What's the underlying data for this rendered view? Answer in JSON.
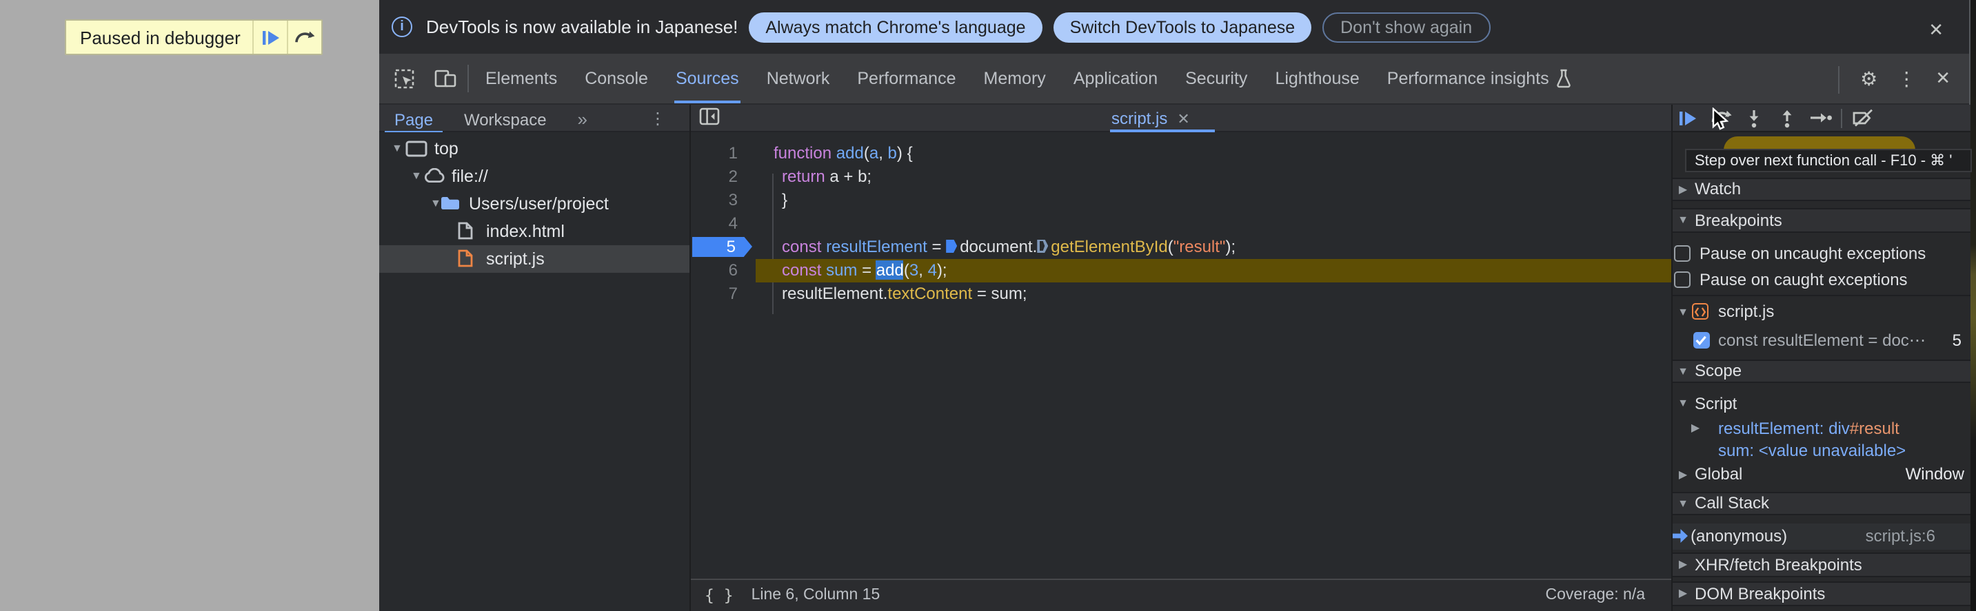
{
  "overlay": {
    "paused_label": "Paused in debugger"
  },
  "banner": {
    "info_icon_glyph": "i",
    "message": "DevTools is now available in Japanese!",
    "buttons": [
      {
        "label": "Always match Chrome's language",
        "style": "filled"
      },
      {
        "label": "Switch DevTools to Japanese",
        "style": "filled"
      },
      {
        "label": "Don't show again",
        "style": "outlined"
      }
    ],
    "close_icon": "✕"
  },
  "icons": {
    "gear": "⚙",
    "more_vertical": "⋮",
    "close": "✕",
    "overflow_chevrons": "»",
    "pretty_print": "{ }",
    "expanded_arrow": "▼",
    "collapsed_arrow": "▶"
  },
  "tabs_row": {
    "selected": "Sources",
    "tabs": [
      {
        "label": "Elements"
      },
      {
        "label": "Console"
      },
      {
        "label": "Sources"
      },
      {
        "label": "Network"
      },
      {
        "label": "Performance"
      },
      {
        "label": "Memory"
      },
      {
        "label": "Application"
      },
      {
        "label": "Security"
      },
      {
        "label": "Lighthouse"
      },
      {
        "label": "Performance insights",
        "flask": true
      }
    ]
  },
  "sources_nav": {
    "tabs": [
      {
        "label": "Page",
        "selected": true
      },
      {
        "label": "Workspace",
        "selected": false
      }
    ],
    "overflow_icon": "»",
    "more_icon": "⋮"
  },
  "file_tree": {
    "items": [
      {
        "label": "top",
        "icon": "frame",
        "depth": 0,
        "expanded": true
      },
      {
        "label": "file://",
        "icon": "cloud",
        "depth": 1,
        "expanded": true
      },
      {
        "label": "Users/user/project",
        "icon": "folder",
        "depth": 2,
        "expanded": true
      },
      {
        "label": "index.html",
        "icon": "file",
        "depth": 3
      },
      {
        "label": "script.js",
        "icon": "file-js",
        "depth": 3,
        "selected": true
      }
    ]
  },
  "editor": {
    "tab": {
      "label": "script.js",
      "close_icon": "✕"
    },
    "breakpoint_line": 5,
    "paused_line": 6,
    "lines": [
      {
        "n": 1,
        "indent": 0,
        "tokens": [
          {
            "t": "function",
            "c": "kw"
          },
          {
            "t": " ",
            "c": "pl"
          },
          {
            "t": "add",
            "c": "def"
          },
          {
            "t": "(",
            "c": "pl"
          },
          {
            "t": "a",
            "c": "def"
          },
          {
            "t": ", ",
            "c": "pl"
          },
          {
            "t": "b",
            "c": "def"
          },
          {
            "t": ") {",
            "c": "pl"
          }
        ]
      },
      {
        "n": 2,
        "indent": 1,
        "tokens": [
          {
            "t": "return",
            "c": "kw"
          },
          {
            "t": " a + b;",
            "c": "pl"
          }
        ]
      },
      {
        "n": 3,
        "indent": 1,
        "tokens": [
          {
            "t": "}",
            "c": "pl"
          }
        ]
      },
      {
        "n": 4,
        "indent": 0,
        "tokens": []
      },
      {
        "n": 5,
        "indent": 1,
        "tokens": [
          {
            "t": "const",
            "c": "kw"
          },
          {
            "t": " ",
            "c": "pl"
          },
          {
            "t": "resultElement",
            "c": "def"
          },
          {
            "t": " = ",
            "c": "pl"
          },
          {
            "m": "filled"
          },
          {
            "t": "document.",
            "c": "pl"
          },
          {
            "m": "outline"
          },
          {
            "t": "getElementById",
            "c": "fn"
          },
          {
            "t": "(",
            "c": "pl"
          },
          {
            "t": "\"result\"",
            "c": "str"
          },
          {
            "t": ");",
            "c": "pl"
          }
        ]
      },
      {
        "n": 6,
        "indent": 1,
        "tokens": [
          {
            "t": "const",
            "c": "kw"
          },
          {
            "t": " ",
            "c": "pl"
          },
          {
            "t": "sum",
            "c": "def"
          },
          {
            "t": " = ",
            "c": "pl"
          },
          {
            "t": "add",
            "c": "sel"
          },
          {
            "t": "(",
            "c": "pl"
          },
          {
            "t": "3",
            "c": "num"
          },
          {
            "t": ", ",
            "c": "pl"
          },
          {
            "t": "4",
            "c": "num"
          },
          {
            "t": ");",
            "c": "pl"
          }
        ]
      },
      {
        "n": 7,
        "indent": 1,
        "tokens": [
          {
            "t": "resultElement.",
            "c": "pl"
          },
          {
            "t": "textContent",
            "c": "fn"
          },
          {
            "t": " = sum;",
            "c": "pl"
          }
        ]
      }
    ]
  },
  "status_bar": {
    "pretty_print_icon": "{ }",
    "position": "Line 6, Column 15",
    "coverage": "Coverage: n/a"
  },
  "debugger": {
    "toolbar": [
      "resume",
      "step-over",
      "step-into",
      "step-out",
      "step",
      "deactivate-breakpoints"
    ],
    "tooltip": "Step over next function call - F10 - ⌘ '",
    "sections": [
      {
        "type": "header",
        "label": "Watch",
        "state": "collapsed"
      },
      {
        "type": "header",
        "label": "Breakpoints",
        "state": "expanded"
      },
      {
        "type": "checkbox",
        "label": "Pause on uncaught exceptions",
        "checked": false
      },
      {
        "type": "checkbox",
        "label": "Pause on caught exceptions",
        "checked": false
      },
      {
        "type": "file-group",
        "label": "script.js",
        "state": "expanded"
      },
      {
        "type": "breakpoint",
        "label": "const resultElement = doc⋯",
        "line": "5",
        "checked": true
      },
      {
        "type": "header",
        "label": "Scope",
        "state": "expanded"
      },
      {
        "type": "scope-group",
        "label": "Script",
        "state": "expanded"
      },
      {
        "type": "variable",
        "name": "resultElement",
        "value": [
          {
            "t": "div",
            "c": "blue"
          },
          {
            "t": "#result",
            "c": "orange"
          }
        ],
        "expandable": true
      },
      {
        "type": "variable",
        "name": "sum",
        "value": [
          {
            "t": "<value unavailable>",
            "c": "blue"
          }
        ],
        "expandable": false
      },
      {
        "type": "scope-group",
        "label": "Global",
        "right": "Window",
        "state": "collapsed"
      },
      {
        "type": "header",
        "label": "Call Stack",
        "state": "expanded"
      },
      {
        "type": "stack-frame",
        "label": "(anonymous)",
        "location": "script.js:6",
        "active": true
      },
      {
        "type": "header",
        "label": "XHR/fetch Breakpoints",
        "state": "collapsed"
      },
      {
        "type": "header",
        "label": "DOM Breakpoints",
        "state": "collapsed"
      }
    ]
  }
}
